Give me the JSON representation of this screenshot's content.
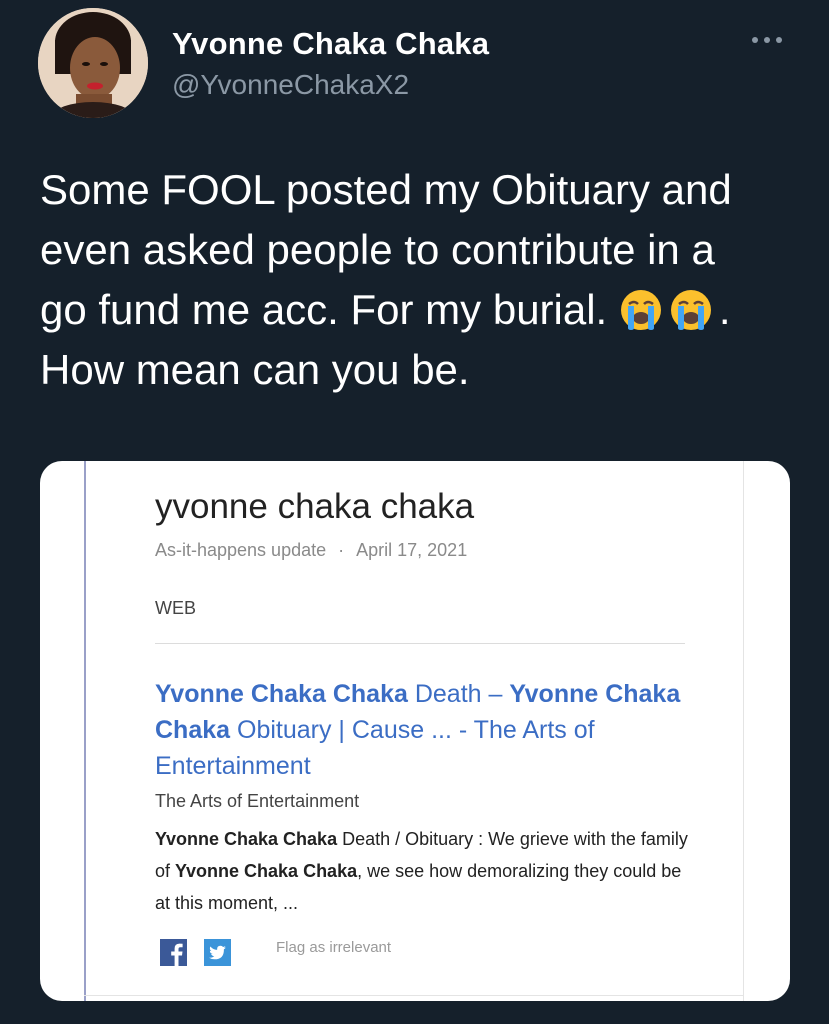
{
  "author": {
    "display_name": "Yvonne Chaka Chaka",
    "handle": "@YvonneChakaX2",
    "avatar_icon": "profile-photo"
  },
  "menu": {
    "icon": "more-horizontal-icon"
  },
  "tweet": {
    "line1": "Some  FOOL posted my Obituary and",
    "line2": "even asked people to contribute in a",
    "line3_before_emoji": "go fund me acc. For my burial. ",
    "line3_after_emoji": ".",
    "line4": "How mean can you be.",
    "emoji": "loudly-crying-face"
  },
  "card": {
    "alert_title": "yvonne chaka chaka",
    "alert_type": "As-it-happens update",
    "separator": "·",
    "alert_date": "April 17, 2021",
    "section": "WEB",
    "result": {
      "title_part1_bold": "Yvonne Chaka Chaka",
      "title_part2": " Death – ",
      "title_part3_bold": "Yvonne Chaka Chaka",
      "title_part4": " Obituary | Cause ... - The Arts of Entertainment",
      "source": "The Arts of Entertainment",
      "snippet_part1_bold": "Yvonne Chaka Chaka",
      "snippet_part2": " Death / Obituary : We grieve with the family of ",
      "snippet_part3_bold": "Yvonne Chaka Chaka",
      "snippet_part4": ", we see how demoralizing they could be at this moment, ..."
    },
    "share_facebook_icon": "facebook-icon",
    "share_twitter_icon": "twitter-icon",
    "flag_label": "Flag as irrelevant"
  },
  "colors": {
    "background": "#15202b",
    "link_blue": "#3b6dc4",
    "handle_gray": "#8b98a5",
    "facebook": "#3b5998",
    "twitter": "#3b94d9"
  }
}
